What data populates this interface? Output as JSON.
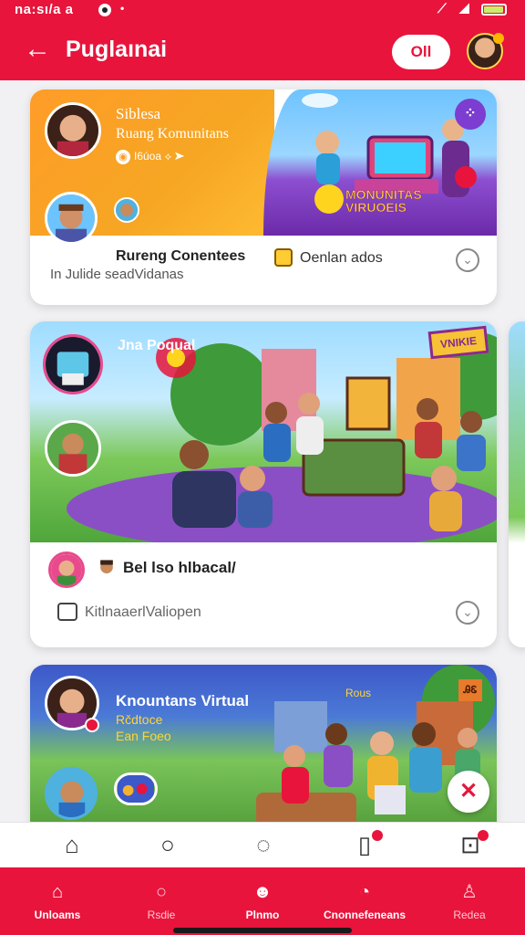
{
  "status_bar": {
    "time": "na:sı/a a",
    "extra": "•"
  },
  "app_bar": {
    "back_icon": "arrow-left-icon",
    "title": "Puglaınai",
    "pill_label": "Oll"
  },
  "cards": {
    "community": {
      "name": "Siblesa",
      "subtitle": "Ruang Komunitans",
      "meta": "I6úoa",
      "scene_title_1": "MONUNITAS",
      "scene_title_2": "VIRUOEIS",
      "menu_icon": "grid-dots-icon",
      "group_title": "Rureng Conentees",
      "group_sub": "In Julide seadVidanas",
      "open_label": "Oenlan ados"
    },
    "gathering": {
      "title": "Jna Poqual",
      "sign": "VNIKIE",
      "post_title": "Bel lso hlbacal/",
      "comment_label": "KitlnaaerlValiopen"
    },
    "virtual": {
      "title": "Knountans Virtual",
      "line2": "Rčdtoce",
      "line3": "Ean Foeo",
      "ribbon": "Rous",
      "sign": "ᎯᏋ",
      "fab_icon": "close-icon"
    }
  },
  "icon_bar": [
    {
      "name": "home-outline-icon",
      "glyph": "⌂"
    },
    {
      "name": "search-icon",
      "glyph": "○"
    },
    {
      "name": "emoji-icon",
      "glyph": "◌"
    },
    {
      "name": "bookmark-icon",
      "glyph": "▯"
    },
    {
      "name": "profile-card-icon",
      "glyph": "⊡"
    }
  ],
  "tabs": [
    {
      "label": "Unloams",
      "active": true
    },
    {
      "label": "Rsdie",
      "active": false
    },
    {
      "label": "Plnmo",
      "active": true
    },
    {
      "label": "Cnonnefeneans",
      "active": true
    },
    {
      "label": "Redea",
      "active": false
    }
  ]
}
